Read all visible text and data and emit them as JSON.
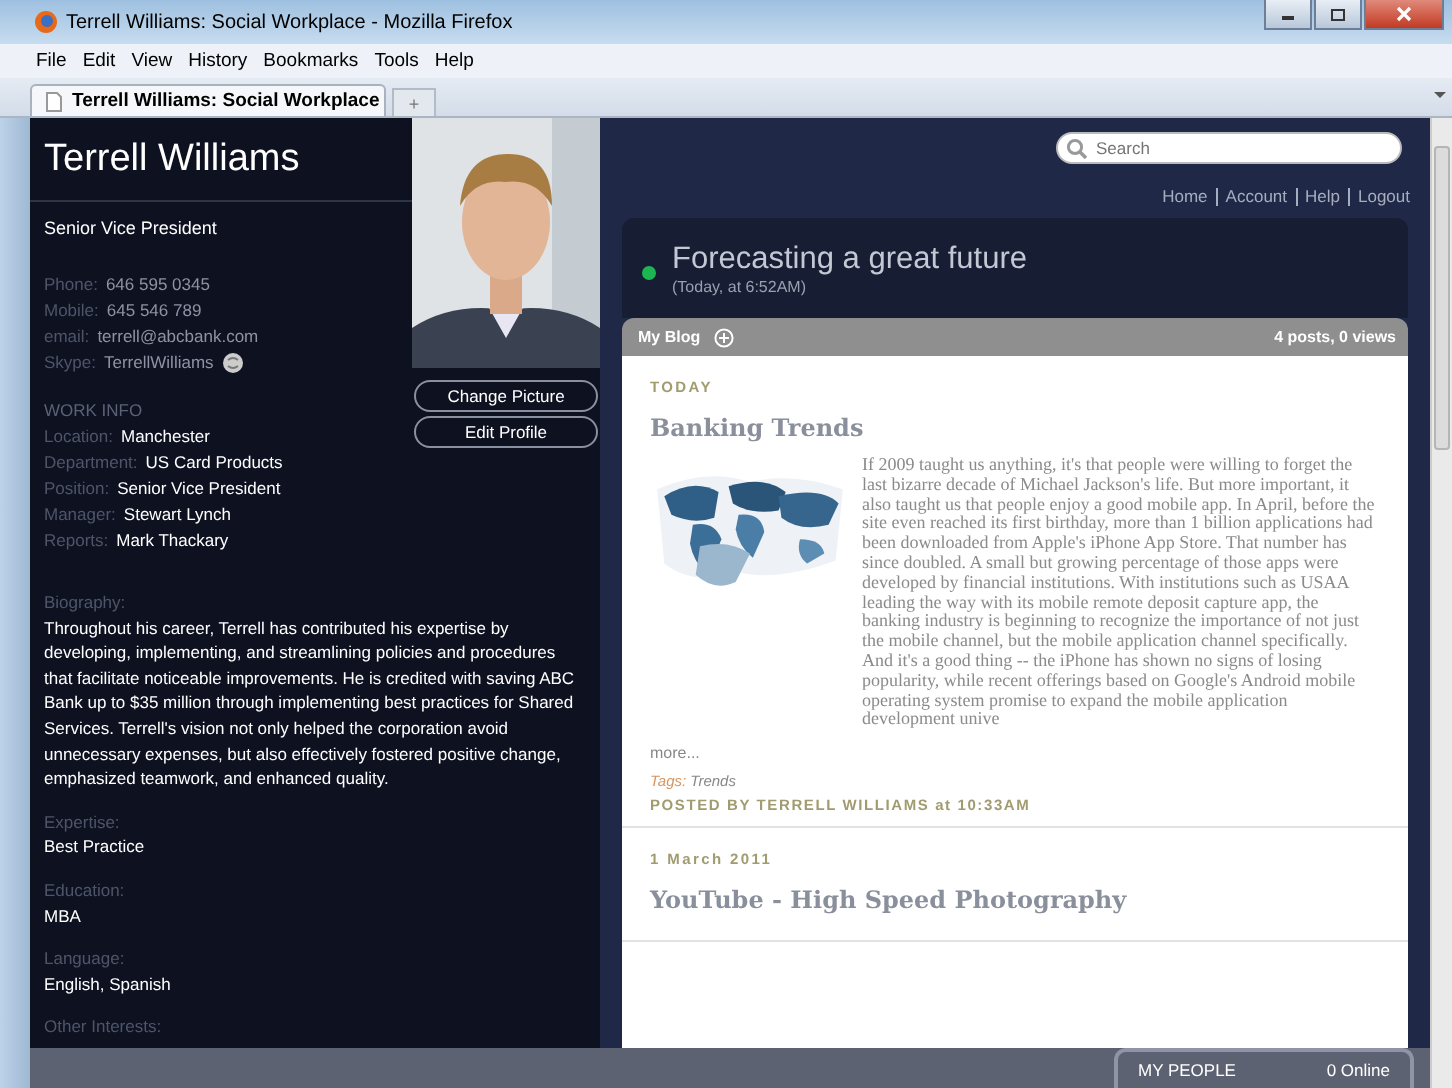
{
  "window": {
    "title": "Terrell Williams: Social Workplace - Mozilla Firefox"
  },
  "menu": [
    "File",
    "Edit",
    "View",
    "History",
    "Bookmarks",
    "Tools",
    "Help"
  ],
  "tabs": [
    {
      "label": "Terrell Williams: Social Workplace",
      "selected": true
    }
  ],
  "new_tab": "+",
  "profile": {
    "name": "Terrell Williams",
    "title": "Senior Vice President",
    "contacts": [
      {
        "label": "Phone:",
        "value": "646 595 0345"
      },
      {
        "label": "Mobile:",
        "value": "645 546 789"
      },
      {
        "label": "email:",
        "value": "terrell@abcbank.com"
      },
      {
        "label": "Skype:",
        "value": "TerrellWilliams"
      }
    ],
    "work_heading": "WORK INFO",
    "work": [
      {
        "label": "Location:",
        "value": "Manchester"
      },
      {
        "label": "Department:",
        "value": "US Card Products"
      },
      {
        "label": "Position:",
        "value": "Senior Vice President"
      },
      {
        "label": "Manager:",
        "value": "Stewart Lynch"
      },
      {
        "label": "Reports:",
        "value": "Mark Thackary"
      }
    ],
    "buttons": [
      "Change Picture",
      "Edit Profile"
    ],
    "sections": [
      {
        "label": "Biography:",
        "value": "Throughout his career, Terrell has contributed his expertise by developing, implementing, and streamlining policies and procedures that facilitate noticeable improvements. He is credited with saving ABC Bank up to $35 million through implementing best practices for Shared Services. Terrell's vision not only helped the corporation avoid unnecessary expenses, but also effectively fostered positive change, emphasized teamwork, and enhanced quality."
      },
      {
        "label": "Expertise:",
        "value": "Best Practice"
      },
      {
        "label": "Education:",
        "value": "MBA"
      },
      {
        "label": "Language:",
        "value": "English, Spanish"
      },
      {
        "label": "Other Interests:"
      }
    ]
  },
  "search": {
    "placeholder": "Search"
  },
  "nav_links": [
    "Home",
    "Account",
    "Help",
    "Logout"
  ],
  "status": {
    "text": "Forecasting a great future",
    "time": "(Today, at 6:52AM)",
    "online": true
  },
  "blog": {
    "title": "My Blog",
    "stats": "4 posts, 0 views",
    "posts": [
      {
        "date": "TODAY",
        "title": "Banking Trends",
        "body": "If 2009 taught us anything, it's that people were willing to forget the last bizarre decade of Michael Jackson's life. But more important, it also taught us that people enjoy a good mobile app. In April, before the site even reached its first birthday, more than 1 billion applications had been downloaded from Apple's iPhone App Store. That number has since doubled. A small but growing percentage of those apps were developed by financial institutions. With institutions such as USAA leading the way with its mobile remote deposit capture app, the banking industry is beginning to recognize the importance of not just the mobile channel, but the mobile application channel specifically. And it's a good thing -- the iPhone has shown no signs of losing popularity, while recent offerings based on Google's Android mobile operating system promise to expand the mobile application development unive",
        "more": "more...",
        "tags_label": "Tags:",
        "tags": "Trends",
        "posted": "POSTED BY TERRELL WILLIAMS at 10:33AM"
      },
      {
        "date": "1 March 2011",
        "title": "YouTube - High Speed Photography"
      }
    ]
  },
  "people_bar": {
    "label": "MY PEOPLE",
    "count": "0 Online"
  }
}
